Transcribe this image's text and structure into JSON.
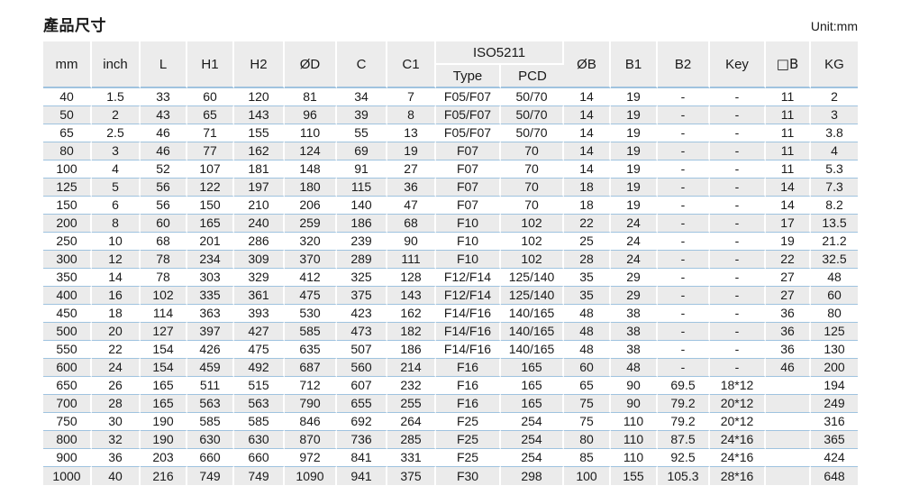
{
  "header": {
    "title": "產品尺寸",
    "unit": "Unit:mm"
  },
  "table": {
    "columns": [
      {
        "key": "mm",
        "label": "mm"
      },
      {
        "key": "inch",
        "label": "inch"
      },
      {
        "key": "L",
        "label": "L"
      },
      {
        "key": "H1",
        "label": "H1"
      },
      {
        "key": "H2",
        "label": "H2"
      },
      {
        "key": "OD",
        "label": "ØD"
      },
      {
        "key": "C",
        "label": "C"
      },
      {
        "key": "C1",
        "label": "C1"
      },
      {
        "key": "type",
        "label": "Type"
      },
      {
        "key": "pcd",
        "label": "PCD"
      },
      {
        "key": "OB",
        "label": "ØB"
      },
      {
        "key": "B1",
        "label": "B1"
      },
      {
        "key": "B2",
        "label": "B2"
      },
      {
        "key": "key",
        "label": "Key"
      },
      {
        "key": "sqB",
        "label": "□B"
      },
      {
        "key": "KG",
        "label": "KG"
      }
    ],
    "group_header": "ISO5211",
    "rows": [
      [
        "40",
        "1.5",
        "33",
        "60",
        "120",
        "81",
        "34",
        "7",
        "F05/F07",
        "50/70",
        "14",
        "19",
        "-",
        "-",
        "11",
        "2"
      ],
      [
        "50",
        "2",
        "43",
        "65",
        "143",
        "96",
        "39",
        "8",
        "F05/F07",
        "50/70",
        "14",
        "19",
        "-",
        "-",
        "11",
        "3"
      ],
      [
        "65",
        "2.5",
        "46",
        "71",
        "155",
        "110",
        "55",
        "13",
        "F05/F07",
        "50/70",
        "14",
        "19",
        "-",
        "-",
        "11",
        "3.8"
      ],
      [
        "80",
        "3",
        "46",
        "77",
        "162",
        "124",
        "69",
        "19",
        "F07",
        "70",
        "14",
        "19",
        "-",
        "-",
        "11",
        "4"
      ],
      [
        "100",
        "4",
        "52",
        "107",
        "181",
        "148",
        "91",
        "27",
        "F07",
        "70",
        "14",
        "19",
        "-",
        "-",
        "11",
        "5.3"
      ],
      [
        "125",
        "5",
        "56",
        "122",
        "197",
        "180",
        "115",
        "36",
        "F07",
        "70",
        "18",
        "19",
        "-",
        "-",
        "14",
        "7.3"
      ],
      [
        "150",
        "6",
        "56",
        "150",
        "210",
        "206",
        "140",
        "47",
        "F07",
        "70",
        "18",
        "19",
        "-",
        "-",
        "14",
        "8.2"
      ],
      [
        "200",
        "8",
        "60",
        "165",
        "240",
        "259",
        "186",
        "68",
        "F10",
        "102",
        "22",
        "24",
        "-",
        "-",
        "17",
        "13.5"
      ],
      [
        "250",
        "10",
        "68",
        "201",
        "286",
        "320",
        "239",
        "90",
        "F10",
        "102",
        "25",
        "24",
        "-",
        "-",
        "19",
        "21.2"
      ],
      [
        "300",
        "12",
        "78",
        "234",
        "309",
        "370",
        "289",
        "111",
        "F10",
        "102",
        "28",
        "24",
        "-",
        "-",
        "22",
        "32.5"
      ],
      [
        "350",
        "14",
        "78",
        "303",
        "329",
        "412",
        "325",
        "128",
        "F12/F14",
        "125/140",
        "35",
        "29",
        "-",
        "-",
        "27",
        "48"
      ],
      [
        "400",
        "16",
        "102",
        "335",
        "361",
        "475",
        "375",
        "143",
        "F12/F14",
        "125/140",
        "35",
        "29",
        "-",
        "-",
        "27",
        "60"
      ],
      [
        "450",
        "18",
        "114",
        "363",
        "393",
        "530",
        "423",
        "162",
        "F14/F16",
        "140/165",
        "48",
        "38",
        "-",
        "-",
        "36",
        "80"
      ],
      [
        "500",
        "20",
        "127",
        "397",
        "427",
        "585",
        "473",
        "182",
        "F14/F16",
        "140/165",
        "48",
        "38",
        "-",
        "-",
        "36",
        "125"
      ],
      [
        "550",
        "22",
        "154",
        "426",
        "475",
        "635",
        "507",
        "186",
        "F14/F16",
        "140/165",
        "48",
        "38",
        "-",
        "-",
        "36",
        "130"
      ],
      [
        "600",
        "24",
        "154",
        "459",
        "492",
        "687",
        "560",
        "214",
        "F16",
        "165",
        "60",
        "48",
        "-",
        "-",
        "46",
        "200"
      ],
      [
        "650",
        "26",
        "165",
        "511",
        "515",
        "712",
        "607",
        "232",
        "F16",
        "165",
        "65",
        "90",
        "69.5",
        "18*12",
        "",
        "194"
      ],
      [
        "700",
        "28",
        "165",
        "563",
        "563",
        "790",
        "655",
        "255",
        "F16",
        "165",
        "75",
        "90",
        "79.2",
        "20*12",
        "",
        "249"
      ],
      [
        "750",
        "30",
        "190",
        "585",
        "585",
        "846",
        "692",
        "264",
        "F25",
        "254",
        "75",
        "110",
        "79.2",
        "20*12",
        "",
        "316"
      ],
      [
        "800",
        "32",
        "190",
        "630",
        "630",
        "870",
        "736",
        "285",
        "F25",
        "254",
        "80",
        "110",
        "87.5",
        "24*16",
        "",
        "365"
      ],
      [
        "900",
        "36",
        "203",
        "660",
        "660",
        "972",
        "841",
        "331",
        "F25",
        "254",
        "85",
        "110",
        "92.5",
        "24*16",
        "",
        "424"
      ],
      [
        "1000",
        "40",
        "216",
        "749",
        "749",
        "1090",
        "941",
        "375",
        "F30",
        "298",
        "100",
        "155",
        "105.3",
        "28*16",
        "",
        "648"
      ]
    ]
  },
  "colors": {
    "header_bg": "#ececec",
    "row_alt_bg": "#ebebeb",
    "rule": "#9fc3df",
    "text": "#1a1a1a"
  }
}
